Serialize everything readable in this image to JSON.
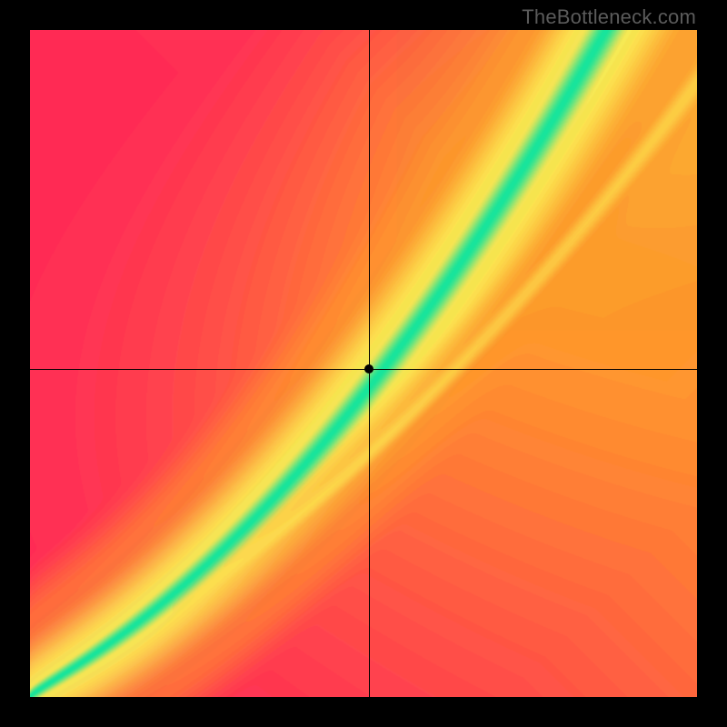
{
  "watermark": "TheBottleneck.com",
  "crosshair": {
    "x_frac": 0.508,
    "y_frac": 0.508
  },
  "dot": {
    "x_frac": 0.508,
    "y_frac": 0.508
  },
  "colors": {
    "red": "#ff2b55",
    "orange": "#ff9a2b",
    "yellow": "#f8ef55",
    "green": "#15e29b",
    "black": "#000000"
  },
  "chart_data": {
    "type": "heatmap",
    "title": "",
    "xlabel": "",
    "ylabel": "",
    "xlim": [
      0,
      1
    ],
    "ylim": [
      0,
      1
    ],
    "note": "Pixel-shader heatmap; the green band marks the optimal diagonal ridge, yellow is near-optimal, orange/red are increasingly bottlenecked regions. Crosshair and dot mark the evaluated point.",
    "optimal_curve_samples": [
      {
        "x": 0.0,
        "y": 0.0
      },
      {
        "x": 0.1,
        "y": 0.09
      },
      {
        "x": 0.2,
        "y": 0.19
      },
      {
        "x": 0.3,
        "y": 0.3
      },
      {
        "x": 0.4,
        "y": 0.43
      },
      {
        "x": 0.5,
        "y": 0.56
      },
      {
        "x": 0.6,
        "y": 0.7
      },
      {
        "x": 0.7,
        "y": 0.82
      },
      {
        "x": 0.8,
        "y": 0.92
      },
      {
        "x": 0.9,
        "y": 0.99
      }
    ],
    "secondary_curve_samples": [
      {
        "x": 0.0,
        "y": 0.0
      },
      {
        "x": 0.2,
        "y": 0.14
      },
      {
        "x": 0.4,
        "y": 0.3
      },
      {
        "x": 0.6,
        "y": 0.48
      },
      {
        "x": 0.8,
        "y": 0.68
      },
      {
        "x": 1.0,
        "y": 0.91
      }
    ],
    "evaluated_point": {
      "x": 0.508,
      "y": 0.492
    }
  }
}
